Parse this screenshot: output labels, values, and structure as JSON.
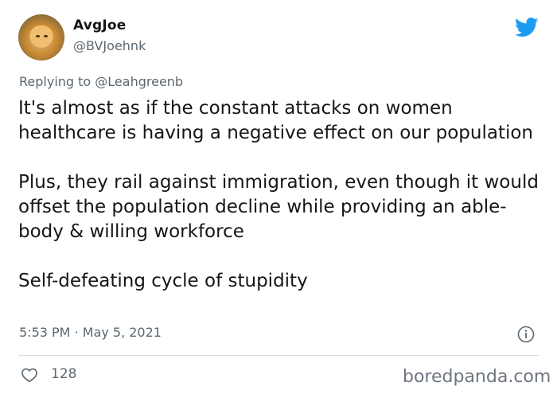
{
  "tweet": {
    "display_name": "AvgJoe",
    "handle": "@BVJoehnk",
    "reply_to": "Replying to @Leahgreenb",
    "paragraphs": [
      "It's almost as if the constant attacks on women healthcare is having a negative effect on our population",
      "Plus, they rail against immigration, even though it would offset the population decline while providing an able-body & willing workforce",
      "Self-defeating cycle of stupidity"
    ],
    "timestamp": "5:53 PM · May 5, 2021",
    "like_count": "128"
  },
  "watermark": "boredpanda.com",
  "icons": {
    "logo": "twitter-bird-icon",
    "info": "info-icon",
    "like": "heart-icon"
  },
  "colors": {
    "twitter_blue": "#1d9bf0",
    "secondary_text": "#5b6770",
    "primary_text": "#141619",
    "divider": "#d6dbe0"
  }
}
